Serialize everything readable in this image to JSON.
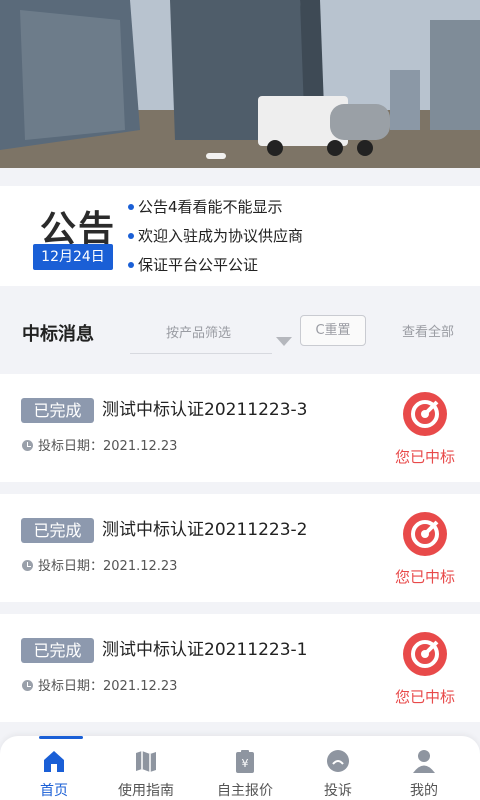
{
  "notice": {
    "title": "公告",
    "date": "12月24日",
    "items": [
      "公告4看看能不能显示",
      "欢迎入驻成为协议供应商",
      "保证平台公平公证"
    ]
  },
  "bids": {
    "title": "中标消息",
    "filter_placeholder": "按产品筛选",
    "reset_label": "C重置",
    "view_all": "查看全部",
    "cards": [
      {
        "status": "已完成",
        "title": "测试中标认证20211223-3",
        "date": "投标日期：2021.12.23",
        "won_label": "您已中标"
      },
      {
        "status": "已完成",
        "title": "测试中标认证20211223-2",
        "date": "投标日期：2021.12.23",
        "won_label": "您已中标"
      },
      {
        "status": "已完成",
        "title": "测试中标认证20211223-1",
        "date": "投标日期：2021.12.23",
        "won_label": "您已中标"
      }
    ]
  },
  "tabs": [
    {
      "label": "首页",
      "icon": "home-icon",
      "active": true
    },
    {
      "label": "使用指南",
      "icon": "map-icon",
      "active": false
    },
    {
      "label": "自主报价",
      "icon": "price-tag-icon",
      "active": false
    },
    {
      "label": "投诉",
      "icon": "complaint-icon",
      "active": false
    },
    {
      "label": "我的",
      "icon": "user-icon",
      "active": false
    }
  ],
  "colors": {
    "accent": "#1a5fd6",
    "won": "#e84a4a",
    "badge": "#8d99ae"
  }
}
